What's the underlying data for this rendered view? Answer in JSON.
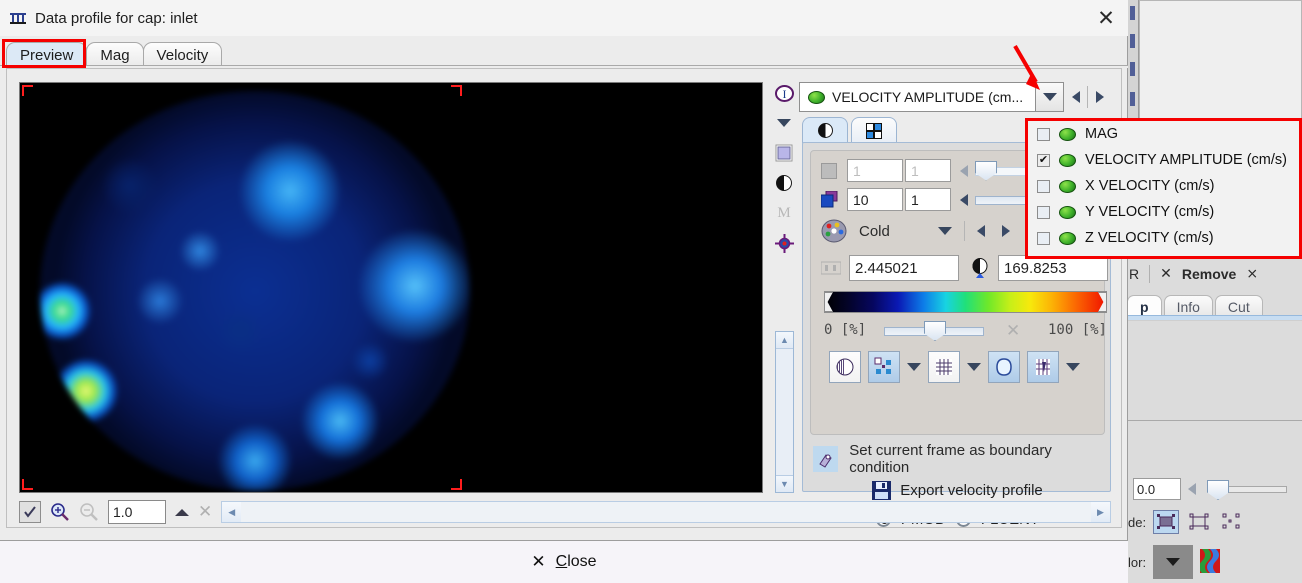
{
  "window": {
    "title": "Data profile for cap: inlet",
    "title_icon": "data-profile-icon",
    "close_glyph": "✕"
  },
  "tabs": [
    {
      "label": "Preview",
      "active": true,
      "highlighted": true
    },
    {
      "label": "Mag",
      "active": false,
      "highlighted": false
    },
    {
      "label": "Velocity",
      "active": false,
      "highlighted": false
    }
  ],
  "preview": {
    "image_description": "velocity amplitude map of circular inlet cross-section",
    "corner_marker_color": "#ff1d1d",
    "background_color": "#000000"
  },
  "viewer_toolbar": {
    "icons": [
      "info-icon",
      "chevron-down-icon",
      "layer-square-icon",
      "contrast-icon",
      "measure-m-icon",
      "crosshair-target-icon"
    ],
    "scroll_up": "▲",
    "scroll_down": "▼"
  },
  "field_selector": {
    "selected_label": "VELOCITY AMPLITUDE (cm...",
    "dot_icon": "green-sphere-icon",
    "dropdown_arrow": "▼",
    "prev_arrow": "◀",
    "next_arrow": "▶"
  },
  "dropdown": {
    "open": true,
    "highlight_color": "#f50000",
    "items": [
      {
        "label": "MAG",
        "checked": false
      },
      {
        "label": "VELOCITY AMPLITUDE (cm/s)",
        "checked": true
      },
      {
        "label": "X VELOCITY (cm/s)",
        "checked": false
      },
      {
        "label": "Y VELOCITY (cm/s)",
        "checked": false
      },
      {
        "label": "Z VELOCITY (cm/s)",
        "checked": false
      }
    ],
    "check_glyph": "✔"
  },
  "panel_tabs": [
    {
      "icon": "contrast-icon",
      "active": true
    },
    {
      "icon": "grid-four-icon",
      "active": false
    }
  ],
  "controls": {
    "row1": {
      "icon": "frame-icon",
      "value_a": "1",
      "value_b": "1",
      "disabled": true,
      "slider_percent": 0
    },
    "row2": {
      "icon": "stack-cubes-icon",
      "value_a": "10",
      "value_b": "1",
      "disabled": false,
      "slider_percent": 92
    },
    "palette": {
      "icon": "palette-icon",
      "name": "Cold",
      "dropdown_arrow": "▼",
      "prev_arrow": "◀",
      "next_arrow": "▶"
    },
    "range": {
      "min_icon": "window-level-icon",
      "min_value": "2.445021",
      "max_icon": "contrast-drop-icon",
      "max_value": "169.8253"
    },
    "opacity": {
      "left_label": "0  [%]",
      "right_label": "100  [%]",
      "slider_percent": 42,
      "reset_icon": "x-reset-icon"
    },
    "tool_buttons": [
      {
        "name": "threshold-button",
        "icon": "threshold-icon",
        "active": false
      },
      {
        "name": "nodes-button",
        "icon": "nodes-icon",
        "active": true
      },
      {
        "name": "nodes-menu",
        "icon": "chevron-down-icon",
        "active": false
      },
      {
        "name": "mesh-button",
        "icon": "mesh-grid-icon",
        "active": false
      },
      {
        "name": "mesh-menu",
        "icon": "chevron-down-icon",
        "active": false
      },
      {
        "name": "surface-button",
        "icon": "surface-blob-icon",
        "active": true
      },
      {
        "name": "volume-button",
        "icon": "volume-render-icon",
        "active": true
      },
      {
        "name": "volume-menu",
        "icon": "chevron-down-icon",
        "active": false
      }
    ]
  },
  "boundary": {
    "set_frame_icon": "boundary-condition-icon",
    "set_frame_label": "Set current frame as boundary condition",
    "export_icon": "floppy-save-icon",
    "export_label": "Export velocity profile",
    "format_options": [
      {
        "label": "PMOD",
        "selected": true
      },
      {
        "label": "FLUENT",
        "selected": false
      }
    ]
  },
  "image_toolbar": {
    "fit_icon": "check-fit-icon",
    "zoom_in_icon": "zoom-in-icon",
    "zoom_out_icon": "zoom-out-icon",
    "zoom_value": "1.0",
    "up_icon": "triangle-up-icon",
    "clear_icon": "x-clear-icon",
    "scroll_left": "◀",
    "scroll_right": "▶"
  },
  "footer": {
    "close_icon": "✕",
    "close_label_prefix": "",
    "close_label": "Close",
    "close_mnemonic": "C",
    "close_rest": "lose"
  },
  "background_app": {
    "toolbar": {
      "left_text": "R",
      "remove_icon": "✕",
      "remove_label": "Remove",
      "next_icon": "⨯"
    },
    "tabs": [
      {
        "label": "p",
        "active": true
      },
      {
        "label": "Info",
        "active": false
      },
      {
        "label": "Cut",
        "active": false
      }
    ],
    "value_field": "0.0",
    "mode_label": "de:",
    "color_label": "lor:",
    "mode_icons": [
      "box-handles-filled-icon",
      "box-handles-outline-icon",
      "points-only-icon"
    ],
    "color_icons": [
      "color-dropdown-icon",
      "color-swatch-icon"
    ]
  },
  "colors": {
    "accent_red": "#f50000",
    "dialog_bg": "#ececec",
    "panel_bg": "#dcdcdc",
    "inner_bg": "#d6d2cd",
    "tab_active": "#dce9f6",
    "green_dot": "#3db02a"
  }
}
